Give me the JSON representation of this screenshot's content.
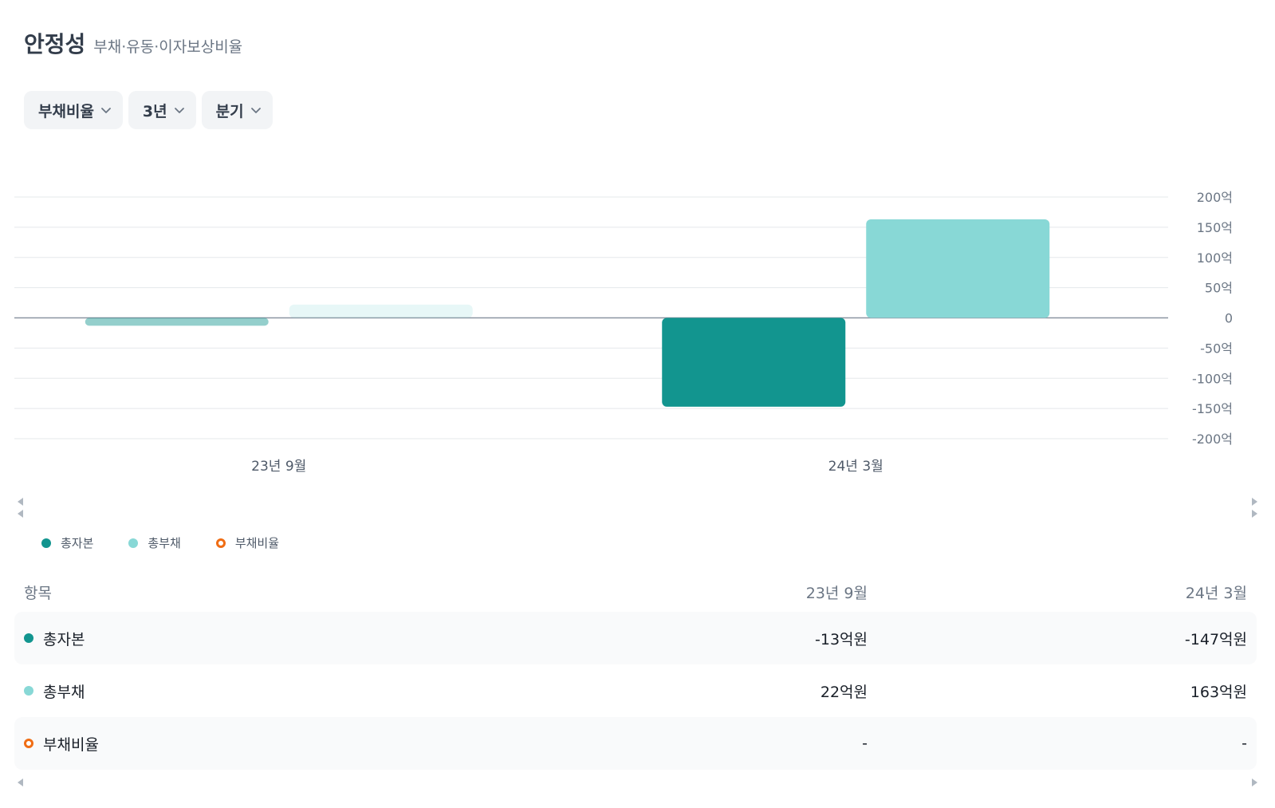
{
  "header": {
    "title": "안정성",
    "subtitle": "부채·유동·이자보상비율"
  },
  "filters": [
    {
      "label": "부채비율"
    },
    {
      "label": "3년"
    },
    {
      "label": "분기"
    }
  ],
  "colors": {
    "total_equity": "#12958f",
    "total_liabilities": "#88d8d6",
    "debt_ratio": "#f06d14",
    "grid": "#e5e8eb",
    "zero_line": "#8b95a1"
  },
  "legend": [
    {
      "label": "총자본",
      "color": "#12958f",
      "style": "filled"
    },
    {
      "label": "총부채",
      "color": "#88d8d6",
      "style": "filled"
    },
    {
      "label": "부채비율",
      "color": "#f06d14",
      "style": "ring"
    }
  ],
  "chart_data": {
    "type": "bar",
    "categories": [
      "23년 9월",
      "24년 3월"
    ],
    "series": [
      {
        "name": "총자본",
        "values": [
          -13,
          -147
        ],
        "color": "#12958f"
      },
      {
        "name": "총부채",
        "values": [
          22,
          163
        ],
        "color": "#88d8d6"
      }
    ],
    "faded_category_index": 0,
    "ylim": [
      -200,
      200
    ],
    "yticks": [
      200,
      150,
      100,
      50,
      0,
      -50,
      -100,
      -150,
      -200
    ],
    "ytick_labels": [
      "200억",
      "150억",
      "100억",
      "50억",
      "0",
      "-50억",
      "-100억",
      "-150억",
      "-200억"
    ],
    "grid": true
  },
  "table": {
    "headers": [
      "항목",
      "23년 9월",
      "24년 3월"
    ],
    "rows": [
      {
        "label": "총자본",
        "values": [
          "-13억원",
          "-147억원"
        ],
        "color": "#12958f",
        "style": "filled"
      },
      {
        "label": "총부채",
        "values": [
          "22억원",
          "163억원"
        ],
        "color": "#88d8d6",
        "style": "filled"
      },
      {
        "label": "부채비율",
        "values": [
          "-",
          "-"
        ],
        "color": "#f06d14",
        "style": "ring"
      }
    ]
  }
}
